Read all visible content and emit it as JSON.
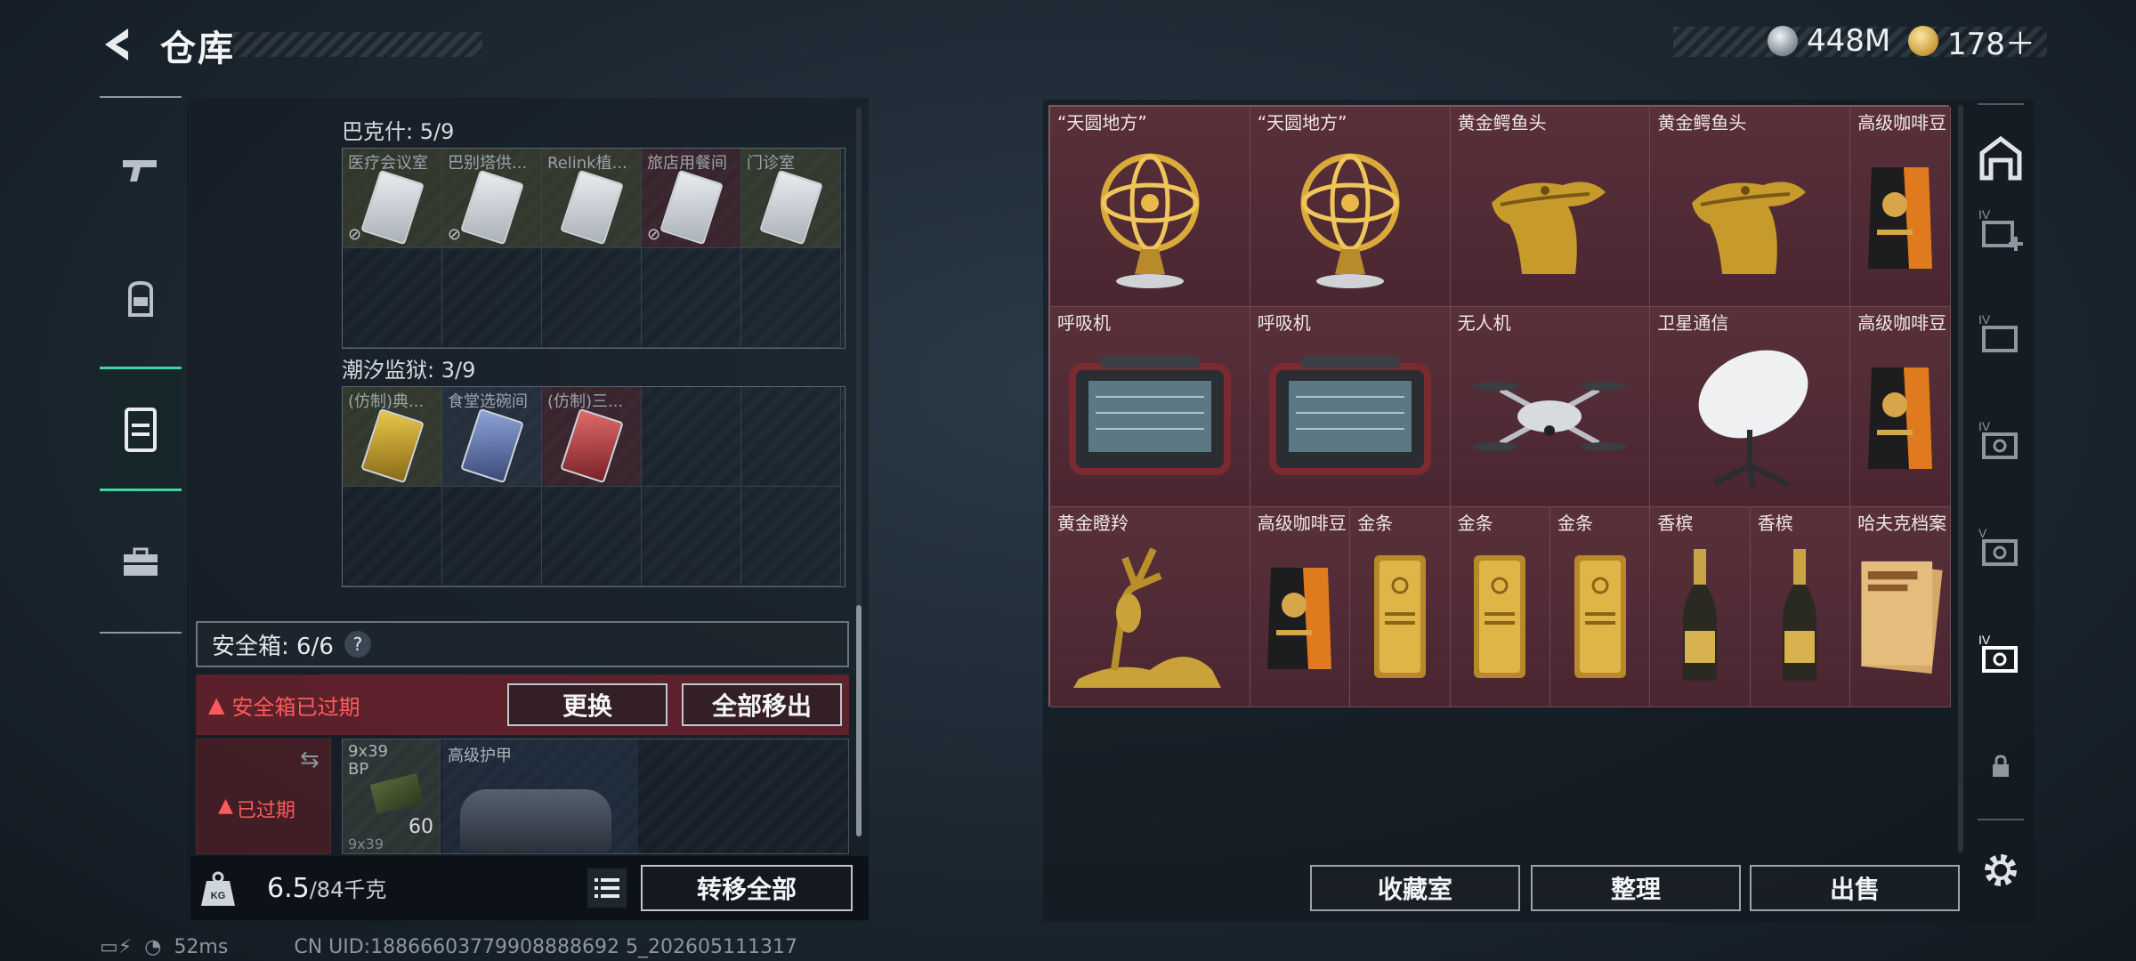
{
  "header": {
    "title": "仓库",
    "currency_silver": "448M",
    "currency_gold": "178＋"
  },
  "left": {
    "sections": [
      {
        "title": "巴克什: 5/9",
        "cells": [
          {
            "label": "医疗会议室",
            "tone": "y",
            "locked": true
          },
          {
            "label": "巴别塔供...",
            "tone": "y",
            "locked": true
          },
          {
            "label": "Relink植...",
            "tone": "y",
            "locked": false
          },
          {
            "label": "旅店用餐间",
            "tone": "r",
            "locked": true
          },
          {
            "label": "门诊室",
            "tone": "y",
            "locked": false
          }
        ]
      },
      {
        "title": "潮汐监狱: 3/9",
        "cells": [
          {
            "label": "(仿制)典...",
            "tone": "y"
          },
          {
            "label": "食堂选碗间",
            "tone": "b"
          },
          {
            "label": "(仿制)三...",
            "tone": "r"
          }
        ]
      }
    ],
    "safebox_label": "安全箱: 6/6",
    "help_glyph": "?",
    "expired_warning": "安全箱已过期",
    "replace_button": "更换",
    "remove_all_button": "全部移出",
    "expired_tag": "已过期",
    "ammo_label": "9x39 BP",
    "ammo_count": "60",
    "ammo_label2": "9x39",
    "armor_label": "高级护甲",
    "weight_current": "6.5",
    "weight_max": "/84千克",
    "kg_label": "KG",
    "transfer_all_button": "转移全部"
  },
  "stash": {
    "items": [
      {
        "label": "“天圆地方”",
        "kind": "globe"
      },
      {
        "label": "“天圆地方”",
        "kind": "globe"
      },
      {
        "label": "黄金鳄鱼头",
        "kind": "croc"
      },
      {
        "label": "黄金鳄鱼头",
        "kind": "croc"
      },
      {
        "label": "高级咖啡豆",
        "kind": "coffee"
      },
      {
        "label": "呼吸机",
        "kind": "ventilator"
      },
      {
        "label": "呼吸机",
        "kind": "ventilator"
      },
      {
        "label": "无人机",
        "kind": "drone"
      },
      {
        "label": "卫星通信",
        "kind": "dish"
      },
      {
        "label": "高级咖啡豆",
        "kind": "coffee"
      },
      {
        "label": "黄金瞪羚",
        "kind": "gazelle"
      },
      {
        "label": "高级咖啡豆",
        "kind": "coffee"
      },
      {
        "label": "金条",
        "kind": "goldbar"
      },
      {
        "label": "金条",
        "kind": "goldbar"
      },
      {
        "label": "金条",
        "kind": "goldbar"
      },
      {
        "label": "香槟",
        "kind": "champagne"
      },
      {
        "label": "香槟",
        "kind": "champagne"
      },
      {
        "label": "哈夫克档案",
        "kind": "file"
      }
    ]
  },
  "bottom_buttons": {
    "collection": "收藏室",
    "organize": "整理",
    "sell": "出售"
  },
  "status": {
    "ping": "52ms",
    "uid": "CN UID:18866603779908888692 5_202605111317"
  },
  "colors": {
    "accent": "#3fd6a1",
    "warning": "#ff5a5a",
    "stash_bg": "#4a2530"
  }
}
